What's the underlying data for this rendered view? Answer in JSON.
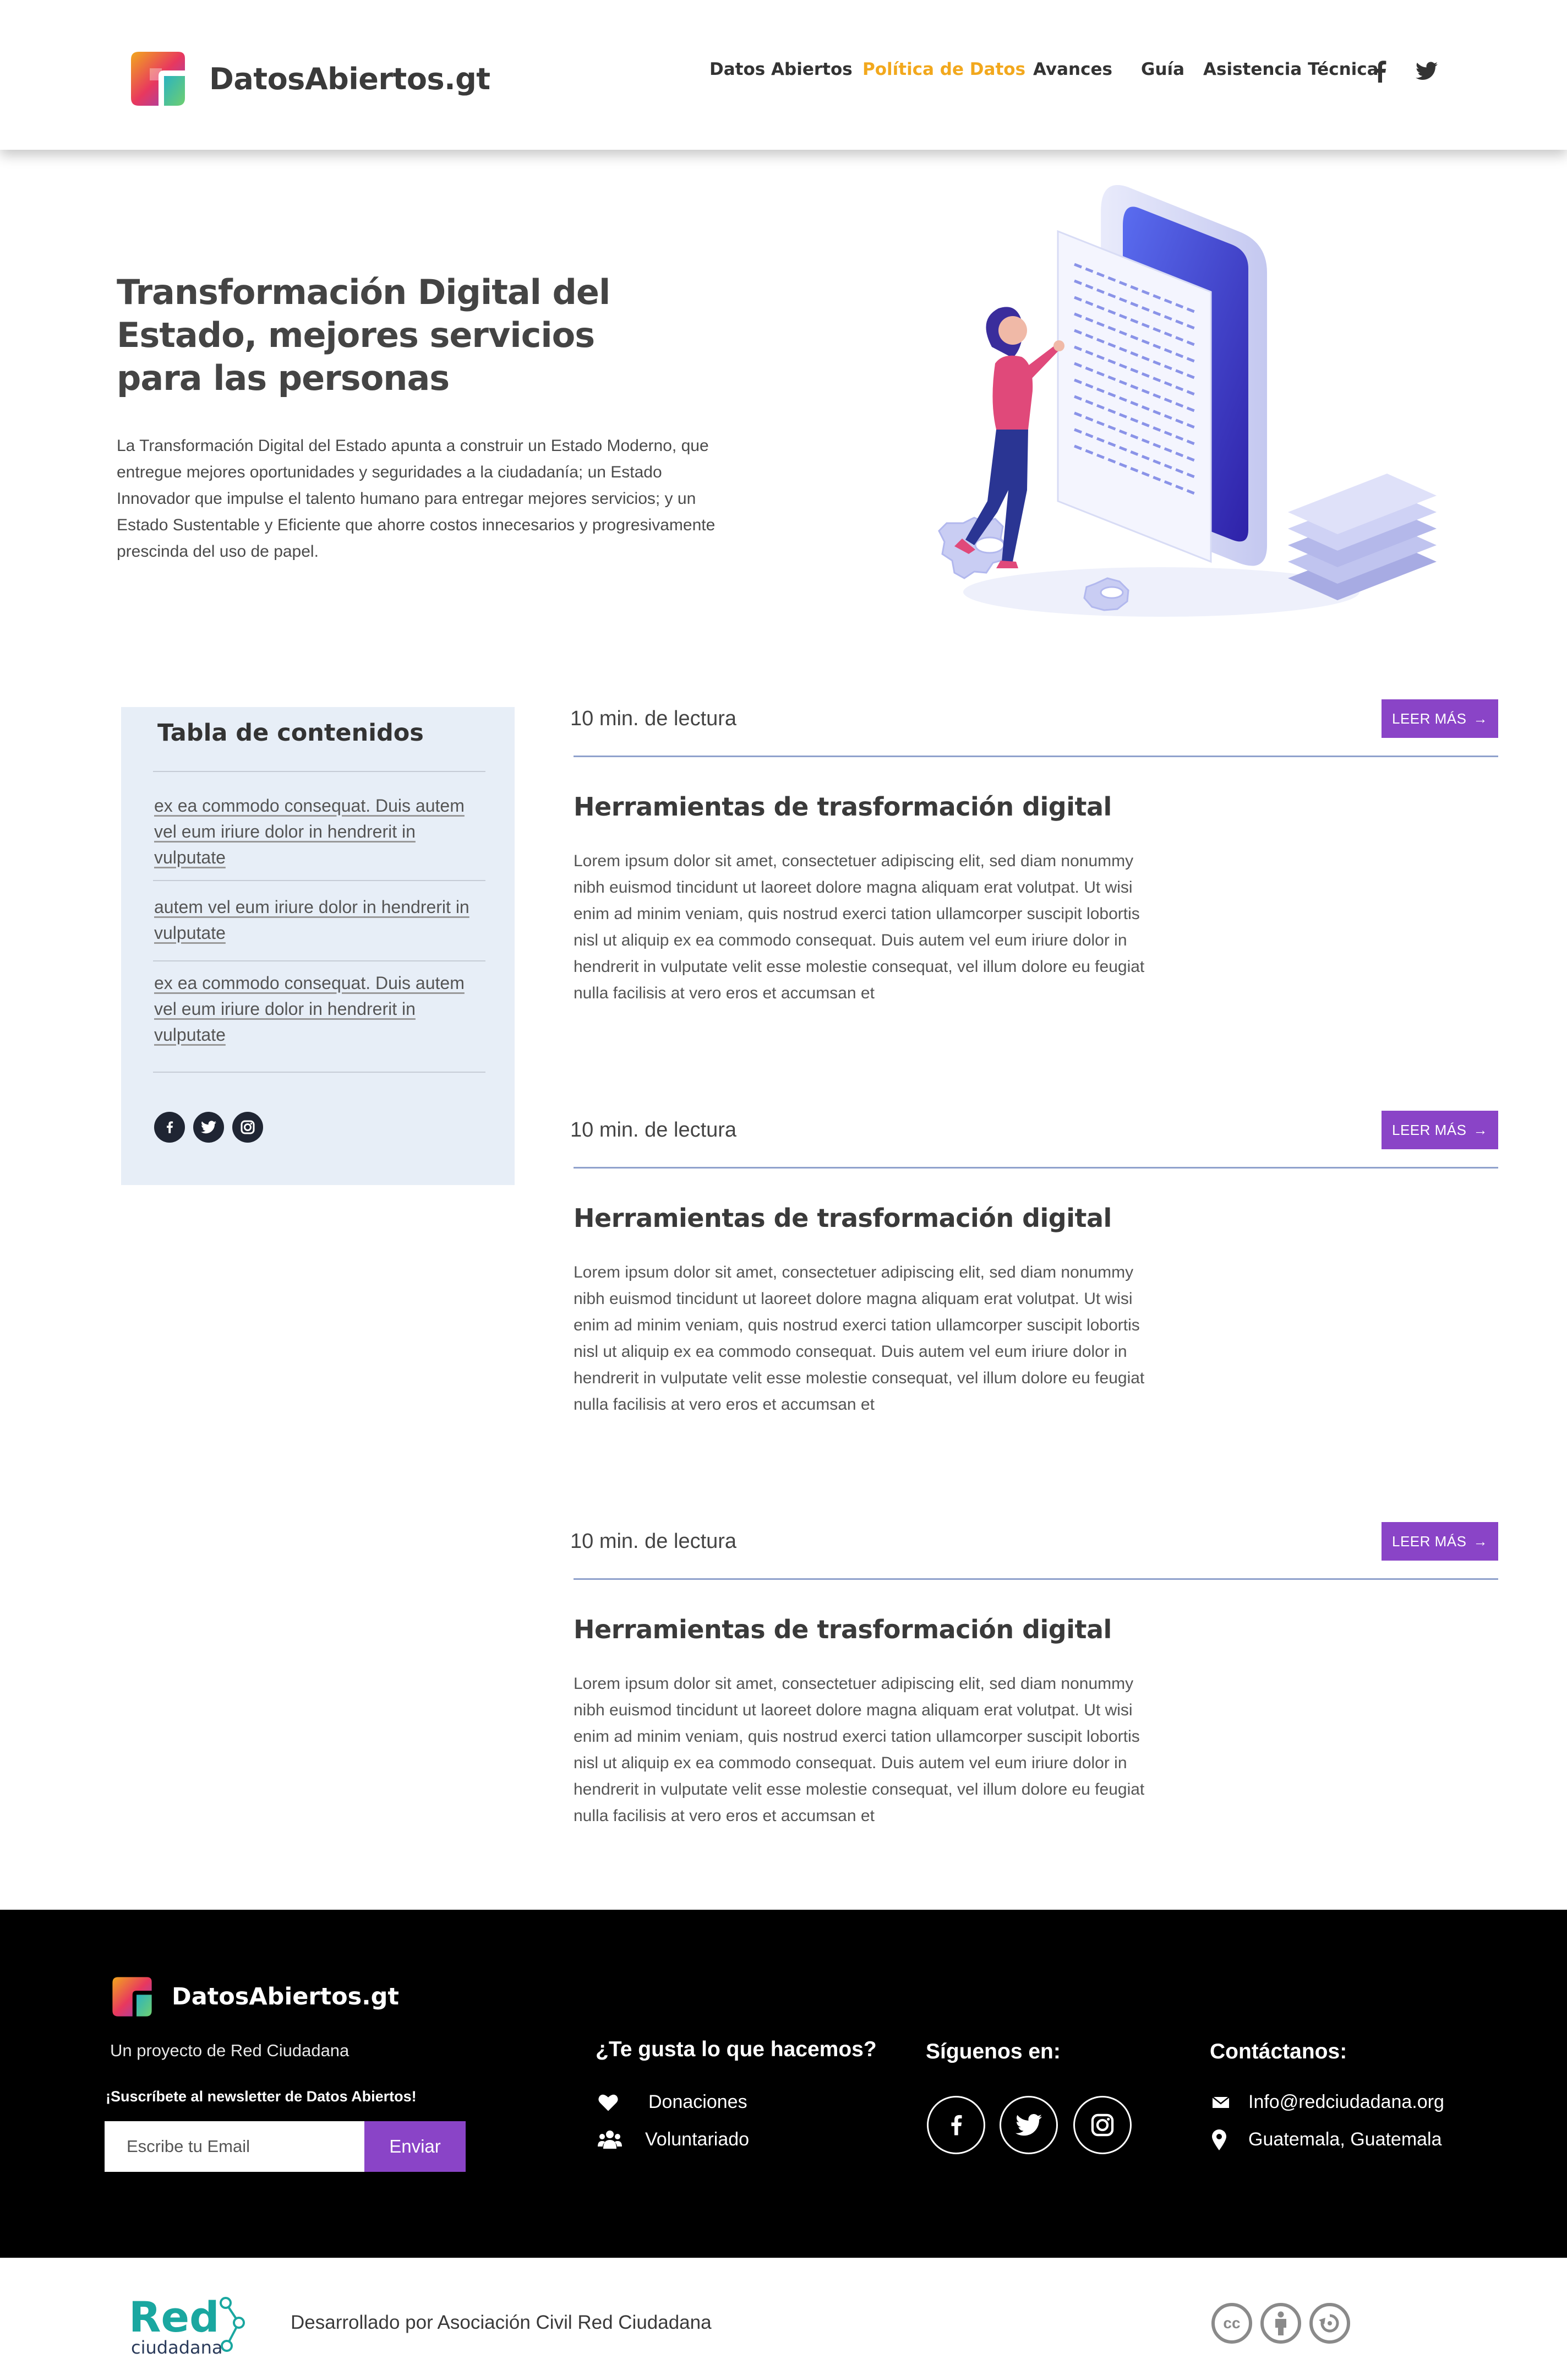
{
  "brand": {
    "name": "DatosAbiertos.gt"
  },
  "nav": {
    "items": [
      {
        "label": "Datos Abiertos",
        "active": false
      },
      {
        "label": "Política de Datos",
        "active": true
      },
      {
        "label": "Avances",
        "active": false
      },
      {
        "label": "Guía",
        "active": false
      },
      {
        "label": "Asistencia Técnica",
        "active": false
      }
    ],
    "social": [
      "facebook-icon",
      "twitter-icon"
    ]
  },
  "hero": {
    "title": "Transformación Digital del Estado, mejores servicios para las personas",
    "text": "La Transformación Digital del Estado apunta a construir un Estado Moderno, que entregue mejores oportunidades y seguridades a la ciudadanía; un Estado Innovador que impulse el talento humano para entregar mejores servicios; y un Estado Sustentable y Eficiente que ahorre costos innecesarios y progresivamente prescinda del uso de papel."
  },
  "toc": {
    "title": "Tabla de contenidos",
    "links": [
      "ex ea commodo consequat. Duis autem vel eum iriure dolor in hendrerit in vulputate",
      "autem vel eum iriure dolor in hendrerit in vulputate",
      "ex ea commodo consequat. Duis autem vel eum iriure dolor in hendrerit in vulputate"
    ],
    "social": [
      "facebook-icon",
      "twitter-icon",
      "instagram-icon"
    ]
  },
  "articles": [
    {
      "read_time": "10 min. de lectura",
      "button": "LEER MÁS",
      "title": "Herramientas de trasformación digital",
      "body": "Lorem ipsum dolor sit amet, consectetuer adipiscing elit, sed diam nonummy nibh euismod tincidunt ut laoreet dolore magna aliquam erat volutpat. Ut wisi enim ad minim veniam, quis nostrud exerci tation ullamcorper suscipit lobortis nisl ut aliquip ex ea commodo consequat. Duis autem vel eum iriure dolor in hendrerit in vulputate velit esse molestie consequat, vel illum dolore eu feugiat nulla facilisis at vero eros et accumsan et"
    },
    {
      "read_time": "10 min. de lectura",
      "button": "LEER MÁS",
      "title": "Herramientas de trasformación digital",
      "body": "Lorem ipsum dolor sit amet, consectetuer adipiscing elit, sed diam nonummy nibh euismod tincidunt ut laoreet dolore magna aliquam erat volutpat. Ut wisi enim ad minim veniam, quis nostrud exerci tation ullamcorper suscipit lobortis nisl ut aliquip ex ea commodo consequat. Duis autem vel eum iriure dolor in hendrerit in vulputate velit esse molestie consequat, vel illum dolore eu feugiat nulla facilisis at vero eros et accumsan et"
    },
    {
      "read_time": "10 min. de lectura",
      "button": "LEER MÁS",
      "title": "Herramientas de trasformación digital",
      "body": "Lorem ipsum dolor sit amet, consectetuer adipiscing elit, sed diam nonummy nibh euismod tincidunt ut laoreet dolore magna aliquam erat volutpat. Ut wisi enim ad minim veniam, quis nostrud exerci tation ullamcorper suscipit lobortis nisl ut aliquip ex ea commodo consequat. Duis autem vel eum iriure dolor in hendrerit in vulputate velit esse molestie consequat, vel illum dolore eu feugiat nulla facilisis at vero eros et accumsan et"
    }
  ],
  "footer": {
    "brand": "DatosAbiertos.gt",
    "tagline": "Un proyecto de Red Ciudadana",
    "newsletter": "¡Suscríbete al newsletter de Datos Abiertos!",
    "email_placeholder": "Escribe tu Email",
    "send": "Enviar",
    "support": {
      "heading": "¿Te gusta lo que hacemos?",
      "items": [
        {
          "icon": "heart-icon",
          "label": "Donaciones"
        },
        {
          "icon": "people-icon",
          "label": "Voluntariado"
        }
      ]
    },
    "follow": {
      "heading": "Síguenos en:",
      "social": [
        "facebook-icon",
        "twitter-icon",
        "instagram-icon"
      ]
    },
    "contact": {
      "heading": "Contáctanos:",
      "items": [
        {
          "icon": "mail-icon",
          "label": "Info@redciudadana.org"
        },
        {
          "icon": "location-pin-icon",
          "label": "Guatemala, Guatemala"
        }
      ]
    }
  },
  "bottom": {
    "logo_text": "Red",
    "logo_sub": "ciudadana",
    "credit": "Desarrollado por Asociación Civil Red Ciudadana",
    "license_icons": [
      "cc-icon",
      "attribution-icon",
      "share-alike-icon"
    ]
  },
  "colors": {
    "accent": "#8a44c7",
    "nav_active": "#f2a81d",
    "footer_bg": "#000000",
    "toc_bg": "#e7eef7",
    "rule": "#8fa1cc"
  }
}
